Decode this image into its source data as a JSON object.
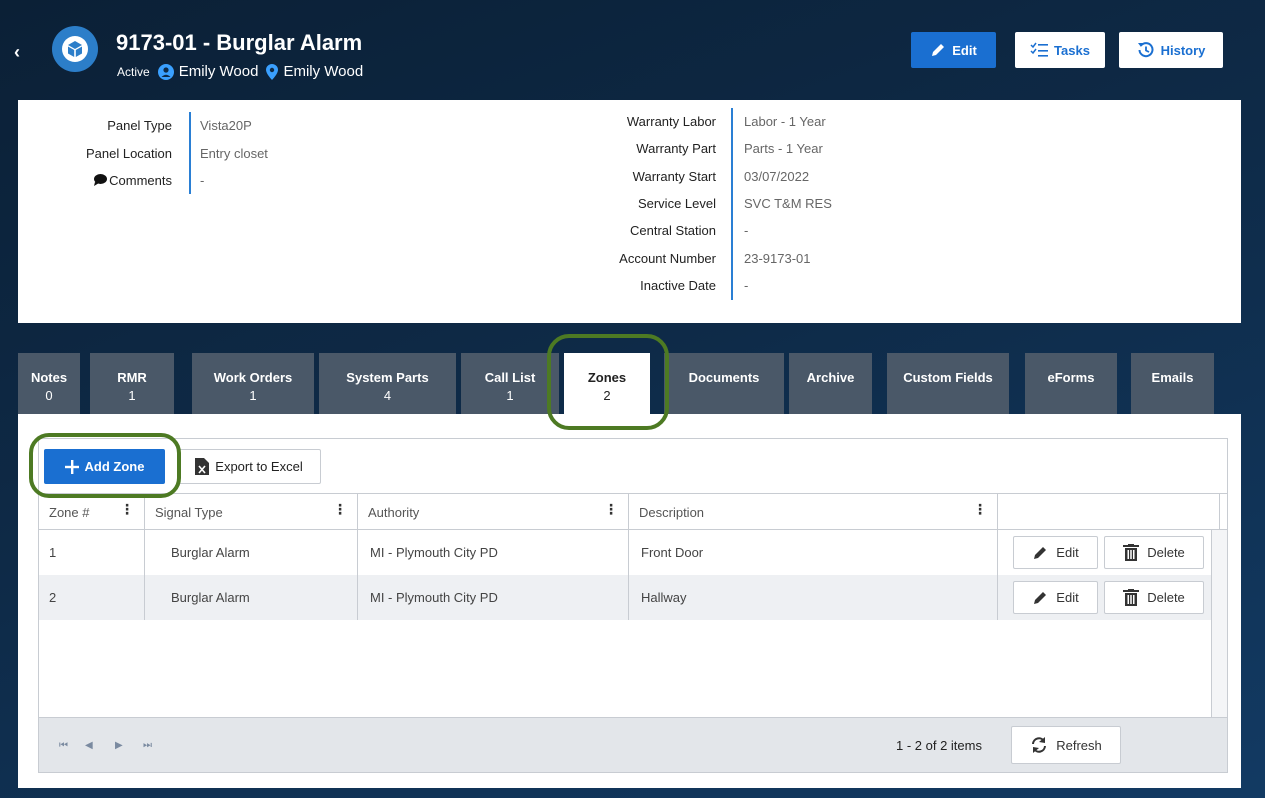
{
  "header": {
    "back_glyph": "‹",
    "title": "9173-01 - Burglar Alarm",
    "status": "Active",
    "customer_name": "Emily Wood",
    "site_name": "Emily Wood",
    "edit_label": "Edit",
    "tasks_label": "Tasks",
    "history_label": "History",
    "accent_color": "#1a6fd1"
  },
  "info_left": [
    {
      "label": "Panel Type",
      "value": "Vista20P"
    },
    {
      "label": "Panel Location",
      "value": "Entry closet"
    },
    {
      "label": "Comments",
      "value": "-",
      "icon": "comment-icon"
    }
  ],
  "info_right": [
    {
      "label": "Warranty Labor",
      "value": "Labor - 1 Year"
    },
    {
      "label": "Warranty Part",
      "value": "Parts - 1 Year"
    },
    {
      "label": "Warranty Start",
      "value": "03/07/2022"
    },
    {
      "label": "Service Level",
      "value": "SVC T&M RES"
    },
    {
      "label": "Central Station",
      "value": "-"
    },
    {
      "label": "Account Number",
      "value": "23-9173-01"
    },
    {
      "label": "Inactive Date",
      "value": "-"
    }
  ],
  "tabs": [
    {
      "label": "Notes",
      "count": "0"
    },
    {
      "label": "RMR",
      "count": "1"
    },
    {
      "label": "Work Orders",
      "count": "1"
    },
    {
      "label": "System Parts",
      "count": "4"
    },
    {
      "label": "Call List",
      "count": "1"
    },
    {
      "label": "Zones",
      "count": "2",
      "active": true
    },
    {
      "label": "Documents",
      "count": ""
    },
    {
      "label": "Archive",
      "count": ""
    },
    {
      "label": "Custom Fields",
      "count": ""
    },
    {
      "label": "eForms",
      "count": ""
    },
    {
      "label": "Emails",
      "count": ""
    }
  ],
  "zones": {
    "add_label": "Add Zone",
    "export_label": "Export to Excel",
    "columns": [
      "Zone #",
      "Signal Type",
      "Authority",
      "Description"
    ],
    "rows": [
      {
        "zone": "1",
        "signal_type": "Burglar Alarm",
        "authority": "MI - Plymouth City PD",
        "description": "Front Door"
      },
      {
        "zone": "2",
        "signal_type": "Burglar Alarm",
        "authority": "MI - Plymouth City PD",
        "description": "Hallway"
      }
    ],
    "row_edit_label": "Edit",
    "row_delete_label": "Delete",
    "pager_info": "1 - 2 of 2 items",
    "refresh_label": "Refresh",
    "pager_first": "⏮",
    "pager_prev": "◀",
    "pager_next": "▶",
    "pager_last": "⏭",
    "menu_glyph": "⋮"
  }
}
